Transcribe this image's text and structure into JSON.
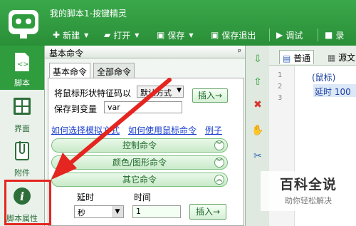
{
  "app": {
    "title": "我的脚本1-按键精灵"
  },
  "toolbar": {
    "new_label": "新建",
    "open_label": "打开",
    "save_label": "保存",
    "save_exit_label": "保存退出",
    "debug_label": "调试",
    "record_label": "录"
  },
  "sidebar": {
    "items": [
      {
        "label": "脚本",
        "icon": "script-icon"
      },
      {
        "label": "界面",
        "icon": "grid-icon"
      },
      {
        "label": "附件",
        "icon": "attachment-icon"
      },
      {
        "label": "脚本属性",
        "icon": "info-icon"
      }
    ]
  },
  "panel": {
    "title": "基本命令",
    "pin": "ᵖ",
    "tabs": [
      "基本命令",
      "全部命令"
    ],
    "cursor_label": "将鼠标形状特征码以",
    "cursor_mode": "默认方式",
    "insert_label": "插入→",
    "save_var_label": "保存到变量",
    "var_value": "var",
    "links": [
      "如何选择模拟方式",
      "如何使用鼠标命令",
      "例子"
    ],
    "categories": [
      "控制命令",
      "颜色/图形命令",
      "其它命令"
    ],
    "delay_label": "延时",
    "time_label": "时间",
    "unit_value": "秒",
    "time_value": "1",
    "insert2_label": "插入→"
  },
  "editor": {
    "tabs": [
      "普通",
      "源文"
    ],
    "line_numbers": [
      "1",
      "2",
      "3"
    ],
    "line1": "(鼠标)",
    "line2": "延时 100"
  },
  "watermark": {
    "title": "百科全说",
    "subtitle": "助你轻松解决"
  },
  "colors": {
    "brand_green": "#2f9c3e",
    "highlight_red": "#e52520"
  }
}
